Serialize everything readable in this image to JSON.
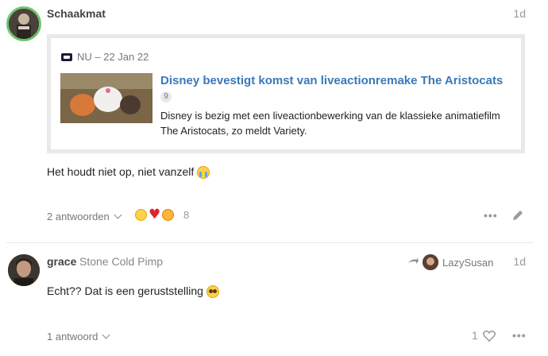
{
  "post1": {
    "username": "Schaakmat",
    "date": "1d",
    "onebox": {
      "source": "NU – 22 Jan 22",
      "title": "Disney bevestigt komst van liveactionremake The Aristocats",
      "badge": "9",
      "description": "Disney is bezig met een liveactionbewerking van de klassieke animatiefilm The Aristocats, zo meldt Variety."
    },
    "text": "Het houdt niet op, niet vanzelf",
    "replies_label": "2 antwoorden",
    "reactions": [
      "sob-emoji",
      "heart-emoji",
      "angry-emoji"
    ],
    "reaction_count": "8"
  },
  "post2": {
    "username": "grace",
    "user_title": "Stone Cold Pimp",
    "reply_to": "LazySusan",
    "date": "1d",
    "text": "Echt?? Dat is een geruststelling",
    "replies_label": "1 antwoord",
    "like_count": "1"
  },
  "colors": {
    "link": "#3b78b9",
    "avatar_ring": "#6ec56e",
    "meta": "#999999"
  }
}
